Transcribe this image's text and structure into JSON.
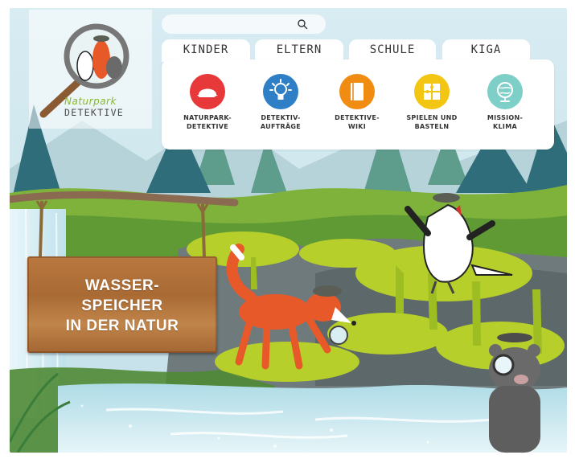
{
  "logo": {
    "line1": "Naturpark",
    "line2": "DETEKTIVE"
  },
  "search": {
    "value": "",
    "placeholder": ""
  },
  "tabs": [
    {
      "label": "KINDER",
      "active": true
    },
    {
      "label": "ELTERN",
      "active": false
    },
    {
      "label": "SCHULE",
      "active": false
    },
    {
      "label": "KIGA",
      "active": false
    }
  ],
  "menu": {
    "items": [
      {
        "line1": "NATURPARK-",
        "line2": "DETEKTIVE",
        "icon": "cap-icon",
        "color": "#e8393a"
      },
      {
        "line1": "DETEKTIV-",
        "line2": "AUFTRÄGE",
        "icon": "lightbulb-icon",
        "color": "#2f7fc6"
      },
      {
        "line1": "DETEKTIVE-",
        "line2": "WIKI",
        "icon": "book-icon",
        "color": "#f08c12"
      },
      {
        "line1": "SPIELEN UND",
        "line2": "BASTELN",
        "icon": "puzzle-icon",
        "color": "#f4c614"
      },
      {
        "line1": "MISSION-",
        "line2": "KLIMA",
        "icon": "globe-icon",
        "color": "#7fcfc9"
      }
    ]
  },
  "hero": {
    "sign_lines": [
      "WASSER-",
      "SPEICHER",
      "IN DER NATUR"
    ]
  },
  "colors": {
    "moss": "#b4cc2a",
    "water": "#9fd3e0",
    "wood": "#a96a34",
    "sky": "#cfe6ee"
  }
}
